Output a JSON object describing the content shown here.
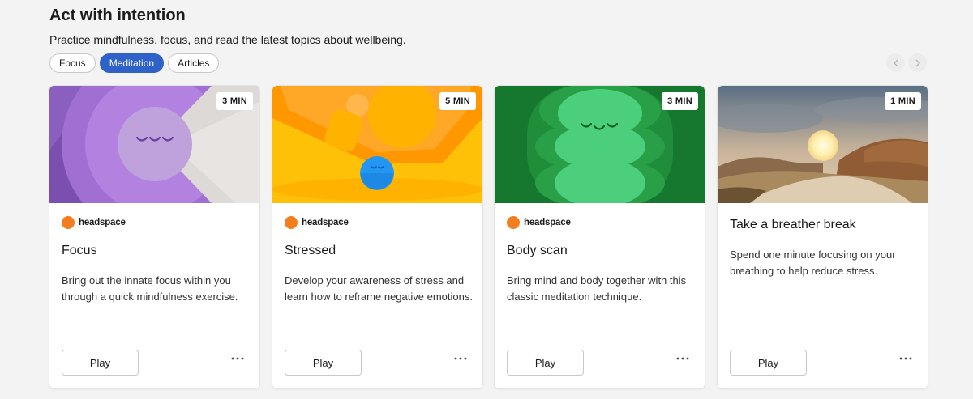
{
  "section": {
    "title": "Act with intention",
    "subtitle": "Practice mindfulness, focus, and read the latest topics about wellbeing."
  },
  "tabs": [
    {
      "label": "Focus",
      "active": false
    },
    {
      "label": "Meditation",
      "active": true
    },
    {
      "label": "Articles",
      "active": false
    }
  ],
  "nav": {
    "prev_icon": "chevron-left-icon",
    "next_icon": "chevron-right-icon"
  },
  "cards": [
    {
      "duration": "3 MIN",
      "provider": "headspace",
      "title": "Focus",
      "description": "Bring out the innate focus within you through a quick mindfulness exercise.",
      "play_label": "Play",
      "more_icon": "more-icon"
    },
    {
      "duration": "5 MIN",
      "provider": "headspace",
      "title": "Stressed",
      "description": "Develop your awareness of stress and learn how to reframe negative emotions.",
      "play_label": "Play",
      "more_icon": "more-icon"
    },
    {
      "duration": "3 MIN",
      "provider": "headspace",
      "title": "Body scan",
      "description": "Bring mind and body together with this classic meditation technique.",
      "play_label": "Play",
      "more_icon": "more-icon"
    },
    {
      "duration": "1 MIN",
      "title": "Take a breather break",
      "description": "Spend one minute focusing on your breathing to help reduce stress.",
      "play_label": "Play",
      "more_icon": "more-icon"
    }
  ],
  "colors": {
    "accent": "#2f62c8",
    "provider_logo": "#f47d20",
    "background": "#f3f3f3"
  }
}
